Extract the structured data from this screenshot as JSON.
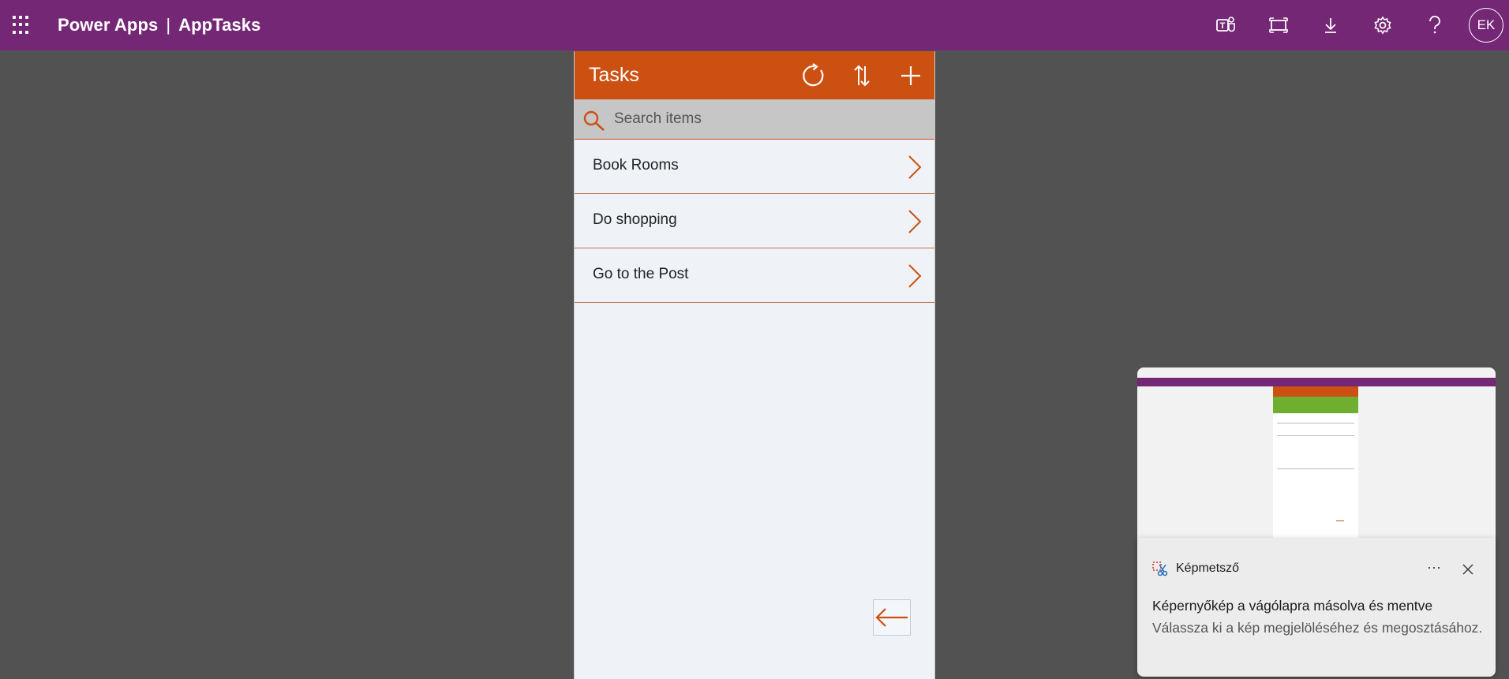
{
  "topbar": {
    "product": "Power Apps",
    "separator": "|",
    "app_name": "AppTasks",
    "avatar_initials": "EK",
    "icons": [
      "teams-icon",
      "fit-to-window-icon",
      "download-icon",
      "settings-icon",
      "help-icon"
    ]
  },
  "app": {
    "header_title": "Tasks",
    "search_placeholder": "Search items",
    "tasks": [
      {
        "label": "Book Rooms"
      },
      {
        "label": "Do shopping"
      },
      {
        "label": "Go to the Post"
      }
    ]
  },
  "toast": {
    "app_name": "Képmetsző",
    "more_label": "···",
    "title": "Képernyőkép a vágólapra másolva és mentve",
    "body": "Válassza ki a kép megjelöléséhez és megosztásához."
  },
  "colors": {
    "topbar": "#742774",
    "app_accent": "#cd5013",
    "background": "#525252",
    "list_background": "#eff3f8"
  }
}
